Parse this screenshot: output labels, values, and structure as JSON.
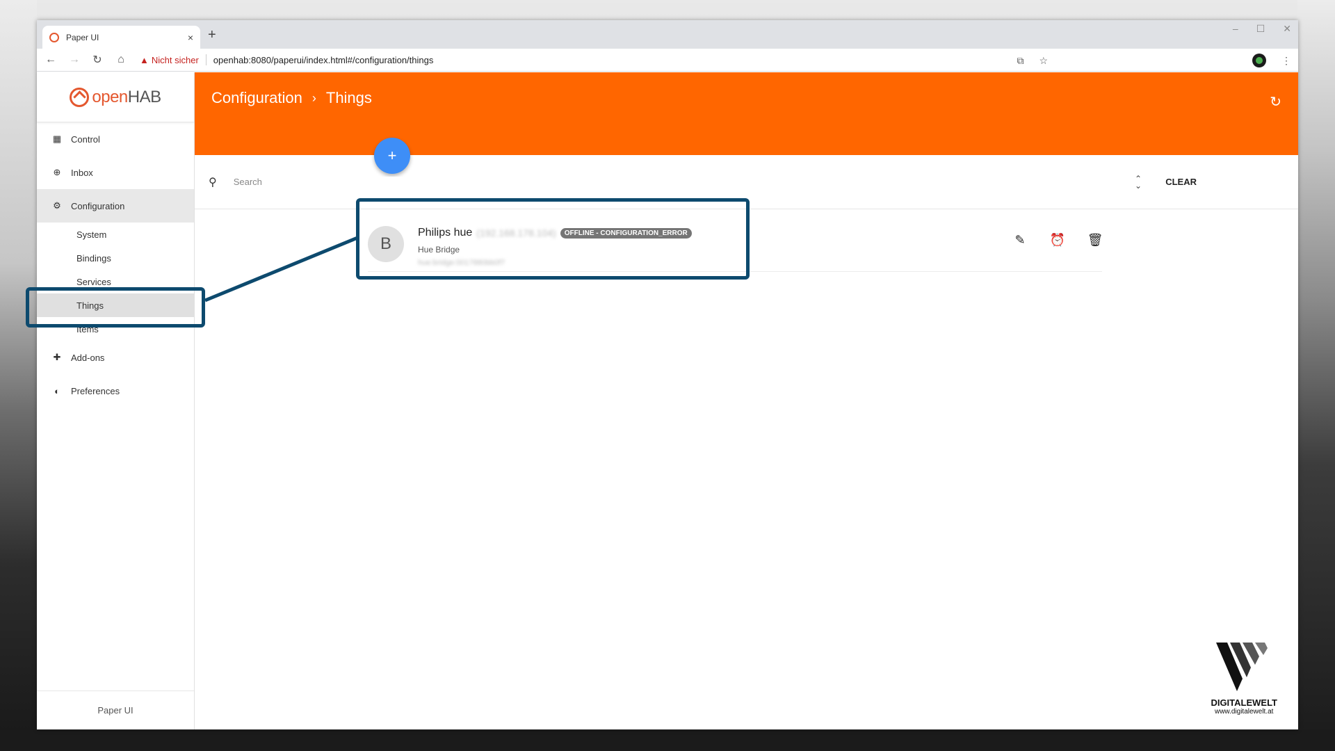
{
  "browser": {
    "tab_title": "Paper UI",
    "tab_close": "×",
    "new_tab": "+",
    "window_controls": [
      "–",
      "☐",
      "✕"
    ],
    "security_label": "Nicht sicher",
    "url": "openhab:8080/paperui/index.html#/configuration/things"
  },
  "brand": {
    "part1": "open",
    "part2": "HAB"
  },
  "sidebar": {
    "items": [
      {
        "label": "Control",
        "icon": "grid-icon"
      },
      {
        "label": "Inbox",
        "icon": "plus-circle-icon"
      },
      {
        "label": "Configuration",
        "icon": "gear-icon"
      }
    ],
    "sub_items": [
      "System",
      "Bindings",
      "Services",
      "Things",
      "Items"
    ],
    "items_bottom": [
      {
        "label": "Add-ons",
        "icon": "puzzle-icon"
      },
      {
        "label": "Preferences",
        "icon": "preferences-icon"
      }
    ],
    "footer": "Paper UI"
  },
  "header": {
    "crumb1": "Configuration",
    "crumb_sep": "›",
    "crumb2": "Things",
    "color": "#ff6600"
  },
  "fab_label": "+",
  "search": {
    "placeholder": "Search",
    "clear_label": "CLEAR"
  },
  "thing": {
    "avatar": "B",
    "name": "Philips hue",
    "ip": "(192.168.178.104)",
    "status": "OFFLINE - CONFIGURATION_ERROR",
    "type": "Hue Bridge",
    "uid": "hue:bridge:0017880bb0f7"
  },
  "watermark": {
    "name": "DIGITALEWELT",
    "url": "www.digitalewelt.at"
  }
}
